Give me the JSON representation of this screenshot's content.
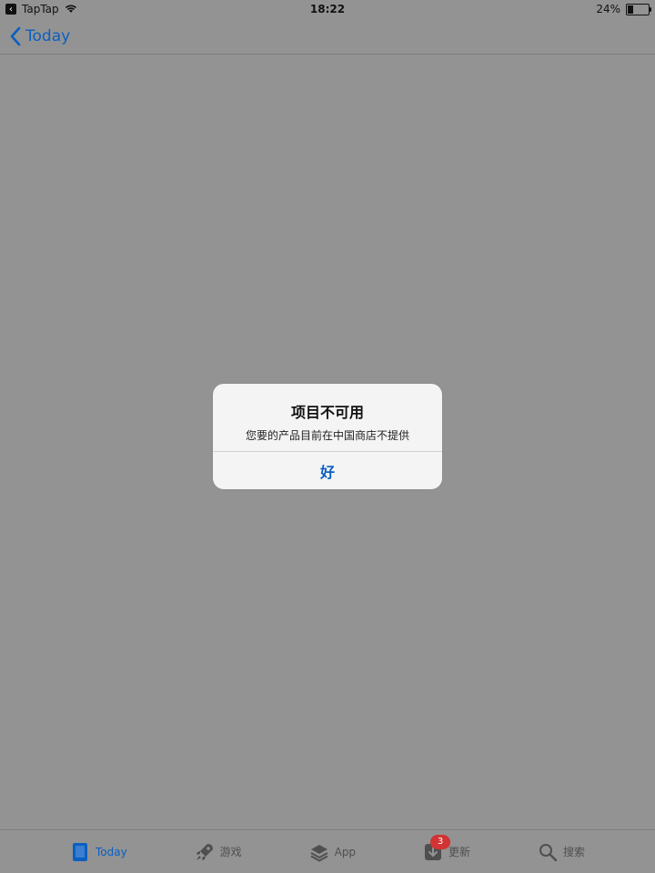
{
  "status_bar": {
    "back_app": "TapTap",
    "time": "18:22",
    "battery": "24%"
  },
  "nav": {
    "back_label": "Today"
  },
  "alert": {
    "title": "项目不可用",
    "message": "您要的产品目前在中国商店不提供",
    "ok": "好"
  },
  "tabs": [
    {
      "label": "Today",
      "icon": "today-icon",
      "active": true
    },
    {
      "label": "游戏",
      "icon": "rocket-icon"
    },
    {
      "label": "App",
      "icon": "layers-icon"
    },
    {
      "label": "更新",
      "icon": "download-icon",
      "badge": "3"
    },
    {
      "label": "搜索",
      "icon": "search-icon"
    }
  ],
  "colors": {
    "overlay_bg": "#939393",
    "accent": "#0b5fc0",
    "badge": "#d23333"
  }
}
